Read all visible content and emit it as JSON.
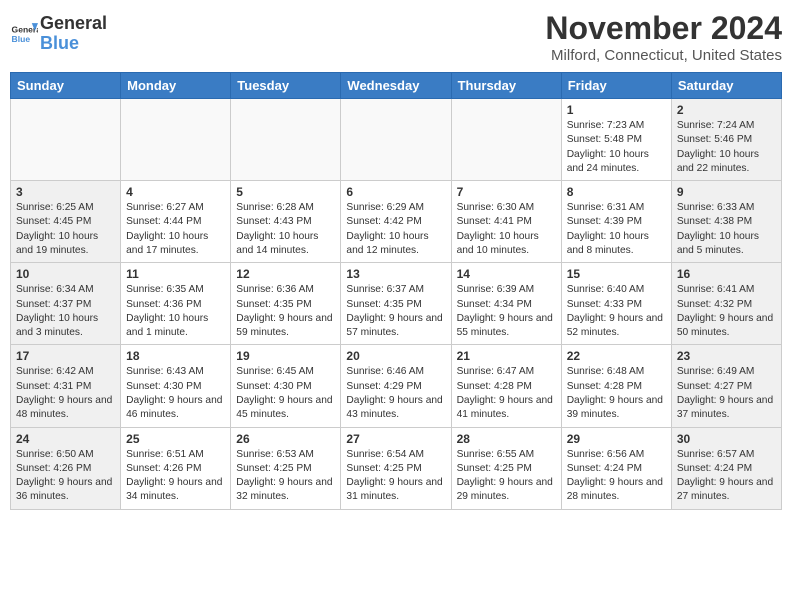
{
  "logo": {
    "line1": "General",
    "line2": "Blue"
  },
  "title": "November 2024",
  "location": "Milford, Connecticut, United States",
  "weekdays": [
    "Sunday",
    "Monday",
    "Tuesday",
    "Wednesday",
    "Thursday",
    "Friday",
    "Saturday"
  ],
  "weeks": [
    [
      {
        "num": "",
        "info": "",
        "type": "empty"
      },
      {
        "num": "",
        "info": "",
        "type": "empty"
      },
      {
        "num": "",
        "info": "",
        "type": "empty"
      },
      {
        "num": "",
        "info": "",
        "type": "empty"
      },
      {
        "num": "",
        "info": "",
        "type": "empty"
      },
      {
        "num": "1",
        "info": "Sunrise: 7:23 AM\nSunset: 5:48 PM\nDaylight: 10 hours\nand 24 minutes.",
        "type": "weekday"
      },
      {
        "num": "2",
        "info": "Sunrise: 7:24 AM\nSunset: 5:46 PM\nDaylight: 10 hours\nand 22 minutes.",
        "type": "weekend"
      }
    ],
    [
      {
        "num": "3",
        "info": "Sunrise: 6:25 AM\nSunset: 4:45 PM\nDaylight: 10 hours\nand 19 minutes.",
        "type": "weekend"
      },
      {
        "num": "4",
        "info": "Sunrise: 6:27 AM\nSunset: 4:44 PM\nDaylight: 10 hours\nand 17 minutes.",
        "type": "weekday"
      },
      {
        "num": "5",
        "info": "Sunrise: 6:28 AM\nSunset: 4:43 PM\nDaylight: 10 hours\nand 14 minutes.",
        "type": "weekday"
      },
      {
        "num": "6",
        "info": "Sunrise: 6:29 AM\nSunset: 4:42 PM\nDaylight: 10 hours\nand 12 minutes.",
        "type": "weekday"
      },
      {
        "num": "7",
        "info": "Sunrise: 6:30 AM\nSunset: 4:41 PM\nDaylight: 10 hours\nand 10 minutes.",
        "type": "weekday"
      },
      {
        "num": "8",
        "info": "Sunrise: 6:31 AM\nSunset: 4:39 PM\nDaylight: 10 hours\nand 8 minutes.",
        "type": "weekday"
      },
      {
        "num": "9",
        "info": "Sunrise: 6:33 AM\nSunset: 4:38 PM\nDaylight: 10 hours\nand 5 minutes.",
        "type": "weekend"
      }
    ],
    [
      {
        "num": "10",
        "info": "Sunrise: 6:34 AM\nSunset: 4:37 PM\nDaylight: 10 hours\nand 3 minutes.",
        "type": "weekend"
      },
      {
        "num": "11",
        "info": "Sunrise: 6:35 AM\nSunset: 4:36 PM\nDaylight: 10 hours\nand 1 minute.",
        "type": "weekday"
      },
      {
        "num": "12",
        "info": "Sunrise: 6:36 AM\nSunset: 4:35 PM\nDaylight: 9 hours\nand 59 minutes.",
        "type": "weekday"
      },
      {
        "num": "13",
        "info": "Sunrise: 6:37 AM\nSunset: 4:35 PM\nDaylight: 9 hours\nand 57 minutes.",
        "type": "weekday"
      },
      {
        "num": "14",
        "info": "Sunrise: 6:39 AM\nSunset: 4:34 PM\nDaylight: 9 hours\nand 55 minutes.",
        "type": "weekday"
      },
      {
        "num": "15",
        "info": "Sunrise: 6:40 AM\nSunset: 4:33 PM\nDaylight: 9 hours\nand 52 minutes.",
        "type": "weekday"
      },
      {
        "num": "16",
        "info": "Sunrise: 6:41 AM\nSunset: 4:32 PM\nDaylight: 9 hours\nand 50 minutes.",
        "type": "weekend"
      }
    ],
    [
      {
        "num": "17",
        "info": "Sunrise: 6:42 AM\nSunset: 4:31 PM\nDaylight: 9 hours\nand 48 minutes.",
        "type": "weekend"
      },
      {
        "num": "18",
        "info": "Sunrise: 6:43 AM\nSunset: 4:30 PM\nDaylight: 9 hours\nand 46 minutes.",
        "type": "weekday"
      },
      {
        "num": "19",
        "info": "Sunrise: 6:45 AM\nSunset: 4:30 PM\nDaylight: 9 hours\nand 45 minutes.",
        "type": "weekday"
      },
      {
        "num": "20",
        "info": "Sunrise: 6:46 AM\nSunset: 4:29 PM\nDaylight: 9 hours\nand 43 minutes.",
        "type": "weekday"
      },
      {
        "num": "21",
        "info": "Sunrise: 6:47 AM\nSunset: 4:28 PM\nDaylight: 9 hours\nand 41 minutes.",
        "type": "weekday"
      },
      {
        "num": "22",
        "info": "Sunrise: 6:48 AM\nSunset: 4:28 PM\nDaylight: 9 hours\nand 39 minutes.",
        "type": "weekday"
      },
      {
        "num": "23",
        "info": "Sunrise: 6:49 AM\nSunset: 4:27 PM\nDaylight: 9 hours\nand 37 minutes.",
        "type": "weekend"
      }
    ],
    [
      {
        "num": "24",
        "info": "Sunrise: 6:50 AM\nSunset: 4:26 PM\nDaylight: 9 hours\nand 36 minutes.",
        "type": "weekend"
      },
      {
        "num": "25",
        "info": "Sunrise: 6:51 AM\nSunset: 4:26 PM\nDaylight: 9 hours\nand 34 minutes.",
        "type": "weekday"
      },
      {
        "num": "26",
        "info": "Sunrise: 6:53 AM\nSunset: 4:25 PM\nDaylight: 9 hours\nand 32 minutes.",
        "type": "weekday"
      },
      {
        "num": "27",
        "info": "Sunrise: 6:54 AM\nSunset: 4:25 PM\nDaylight: 9 hours\nand 31 minutes.",
        "type": "weekday"
      },
      {
        "num": "28",
        "info": "Sunrise: 6:55 AM\nSunset: 4:25 PM\nDaylight: 9 hours\nand 29 minutes.",
        "type": "weekday"
      },
      {
        "num": "29",
        "info": "Sunrise: 6:56 AM\nSunset: 4:24 PM\nDaylight: 9 hours\nand 28 minutes.",
        "type": "weekday"
      },
      {
        "num": "30",
        "info": "Sunrise: 6:57 AM\nSunset: 4:24 PM\nDaylight: 9 hours\nand 27 minutes.",
        "type": "weekend"
      }
    ]
  ]
}
